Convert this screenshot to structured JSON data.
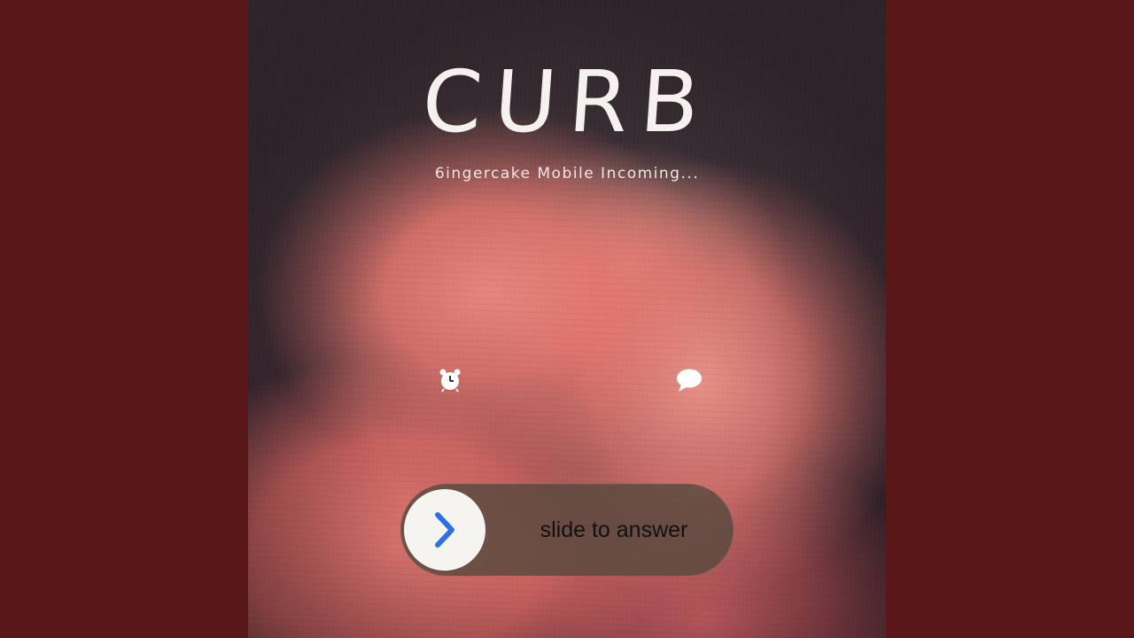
{
  "cover": {
    "title": "CURB",
    "subtitle": "6ingercake Mobile Incoming..."
  },
  "icons": {
    "alarm": "alarm-clock-icon",
    "message": "speech-bubble-icon"
  },
  "slider": {
    "label": "slide to answer",
    "knob_icon": "chevron-right-icon"
  },
  "colors": {
    "background": "#5a1719",
    "slider_track": "#52483c",
    "chevron": "#2f6fe6",
    "title_text": "#f4f1ee"
  }
}
